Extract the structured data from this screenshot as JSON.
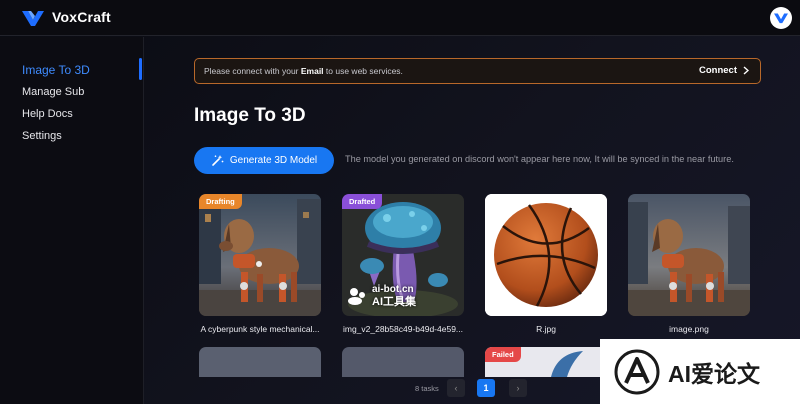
{
  "app": {
    "name": "VoxCraft"
  },
  "sidebar": {
    "items": [
      {
        "label": "Image To 3D",
        "active": true
      },
      {
        "label": "Manage Sub"
      },
      {
        "label": "Help Docs"
      },
      {
        "label": "Settings"
      }
    ]
  },
  "banner": {
    "text_before": "Please connect with your ",
    "text_bold": "Email",
    "text_after": " to use web services.",
    "action": "Connect"
  },
  "page": {
    "title": "Image To 3D",
    "generate_button": "Generate 3D Model",
    "note": "The model you generated on discord won't appear here now, It will be synced in the near future."
  },
  "cards": [
    {
      "caption": "A cyberpunk style mechanical...",
      "badge": "Drafting",
      "badge_color": "#e8862a",
      "image": "robot-dog"
    },
    {
      "caption": "img_v2_28b58c49-b49d-4e59...",
      "badge": "Drafted",
      "badge_color": "#8a4fd8",
      "image": "mushroom"
    },
    {
      "caption": "R.jpg",
      "badge": "",
      "image": "basketball"
    },
    {
      "caption": "image.png",
      "badge": "",
      "image": "robot-dog"
    }
  ],
  "second_row": [
    {
      "badge": ""
    },
    {
      "badge": ""
    },
    {
      "badge": "Failed",
      "badge_color": "#e54848"
    },
    {
      "badge": ""
    }
  ],
  "pagination": {
    "count": "8 tasks",
    "current": "1",
    "prev": "‹",
    "next": "›"
  },
  "watermarks": {
    "small_top": "ai-bot.cn",
    "small_bottom": "AI工具集",
    "large": "AI爱论文"
  },
  "colors": {
    "accent": "#1877f2",
    "banner_border": "#b8682a",
    "active_nav": "#3f8cff"
  }
}
